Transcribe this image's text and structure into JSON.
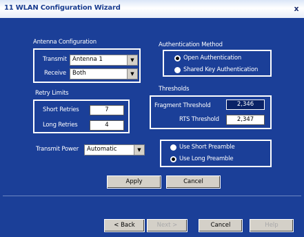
{
  "window": {
    "title": "11 WLAN Configuration Wizard",
    "close": "x"
  },
  "antenna": {
    "group_label": "Antenna Configuration",
    "transmit_label": "Transmit",
    "transmit_value": "Antenna 1",
    "receive_label": "Receive",
    "receive_value": "Both"
  },
  "retry": {
    "group_label": "Retry Limits",
    "short_label": "Short Retries",
    "short_value": "7",
    "long_label": "Long Retries",
    "long_value": "4"
  },
  "transmit_power": {
    "label": "Transmit Power",
    "value": "Automatic"
  },
  "auth": {
    "group_label": "Authentication Method",
    "open_label": "Open Authentication",
    "shared_label": "Shared Key Authentication",
    "selected": "open"
  },
  "thresholds": {
    "group_label": "Thresholds",
    "fragment_label": "Fragment Threshold",
    "fragment_value": "2,346",
    "rts_label": "RTS Threshold",
    "rts_value": "2,347"
  },
  "preamble": {
    "short_label": "Use Short Preamble",
    "long_label": "Use Long Preamble",
    "selected": "long"
  },
  "actions": {
    "apply": "Apply",
    "cancel": "Cancel"
  },
  "wizard": {
    "back": "< Back",
    "next": "Next >",
    "cancel": "Cancel",
    "help": "Help"
  },
  "colors": {
    "background": "#1b3f98",
    "text": "#ffffff"
  }
}
